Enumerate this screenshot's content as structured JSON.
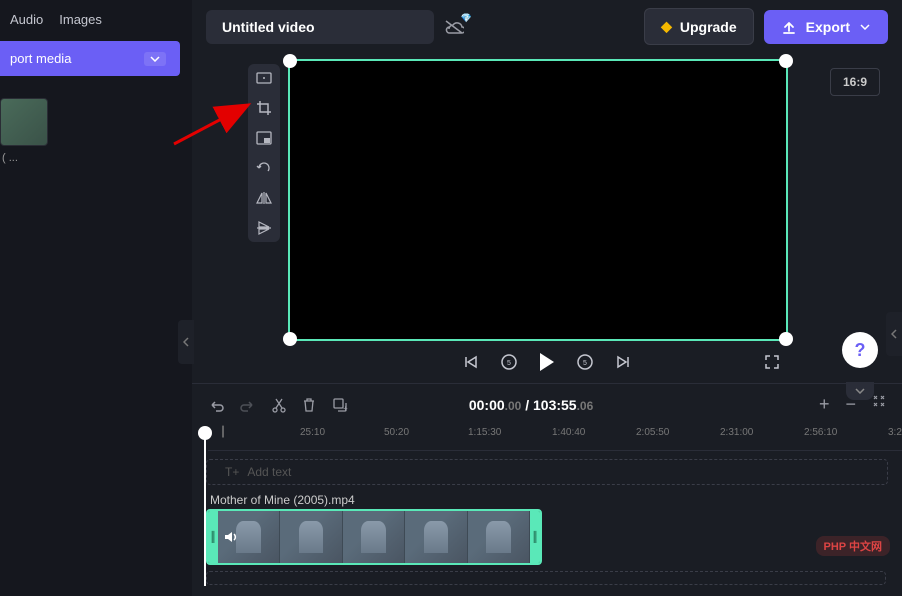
{
  "sidebar": {
    "tabs": [
      "Audio",
      "Images"
    ],
    "import_label": "port media",
    "media_label": "( ..."
  },
  "topbar": {
    "title": "Untitled video",
    "upgrade_label": "Upgrade",
    "export_label": "Export"
  },
  "preview": {
    "aspect_ratio": "16:9"
  },
  "playback": {
    "current_time": "00:00",
    "current_frames": ".00",
    "total_time": "103:55",
    "total_frames": ".06"
  },
  "ruler": {
    "ticks": [
      "25:10",
      "50:20",
      "1:15:30",
      "1:40:40",
      "2:05:50",
      "2:31:00",
      "2:56:10",
      "3:2"
    ]
  },
  "timeline": {
    "add_text_label": "Add text",
    "clip_name": "Mother of Mine (2005).mp4"
  },
  "watermark": "PHP 中文网"
}
